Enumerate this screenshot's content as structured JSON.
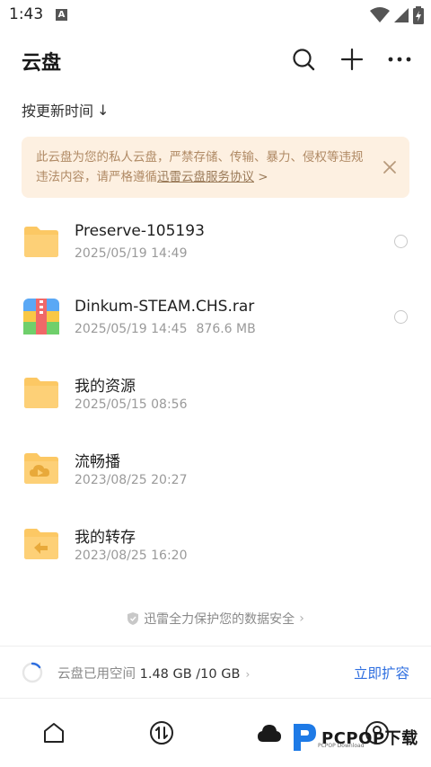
{
  "status_bar": {
    "time": "1:43",
    "notification_letter": "A"
  },
  "header": {
    "title": "云盘"
  },
  "sort": {
    "label": "按更新时间",
    "arrow": "↓"
  },
  "notice": {
    "text": "此云盘为您的私人云盘，严禁存储、传输、暴力、侵权等违规违法内容，请严格遵循",
    "link": "迅雷云盘服务协议",
    "link_suffix": " >"
  },
  "files": [
    {
      "name": "Preserve-105193",
      "date": "2025/05/19 14:49",
      "size": "",
      "icon": "folder-icon"
    },
    {
      "name": "Dinkum-STEAM.CHS.rar",
      "date": "2025/05/19 14:45",
      "size": "876.6 MB",
      "icon": "archive-icon"
    },
    {
      "name": "我的资源",
      "date": "2025/05/15 08:56",
      "size": "",
      "icon": "folder-icon"
    },
    {
      "name": "流畅播",
      "date": "2023/08/25 20:27",
      "size": "",
      "icon": "cloud-play-folder-icon"
    },
    {
      "name": "我的转存",
      "date": "2023/08/25 16:20",
      "size": "",
      "icon": "transfer-folder-icon"
    }
  ],
  "security_note": "迅雷全力保护您的数据安全",
  "storage": {
    "label": "云盘已用空间",
    "used": "1.48 GB",
    "total": "/10 GB",
    "used_fraction": 0.148,
    "expand_label": "立即扩容"
  },
  "watermark": {
    "text": "PCPOP下载",
    "sub": "PCPOP Download"
  },
  "colors": {
    "accent": "#2f6fe0",
    "folder": "#fcc864",
    "notice_bg": "#fdf0e1"
  }
}
